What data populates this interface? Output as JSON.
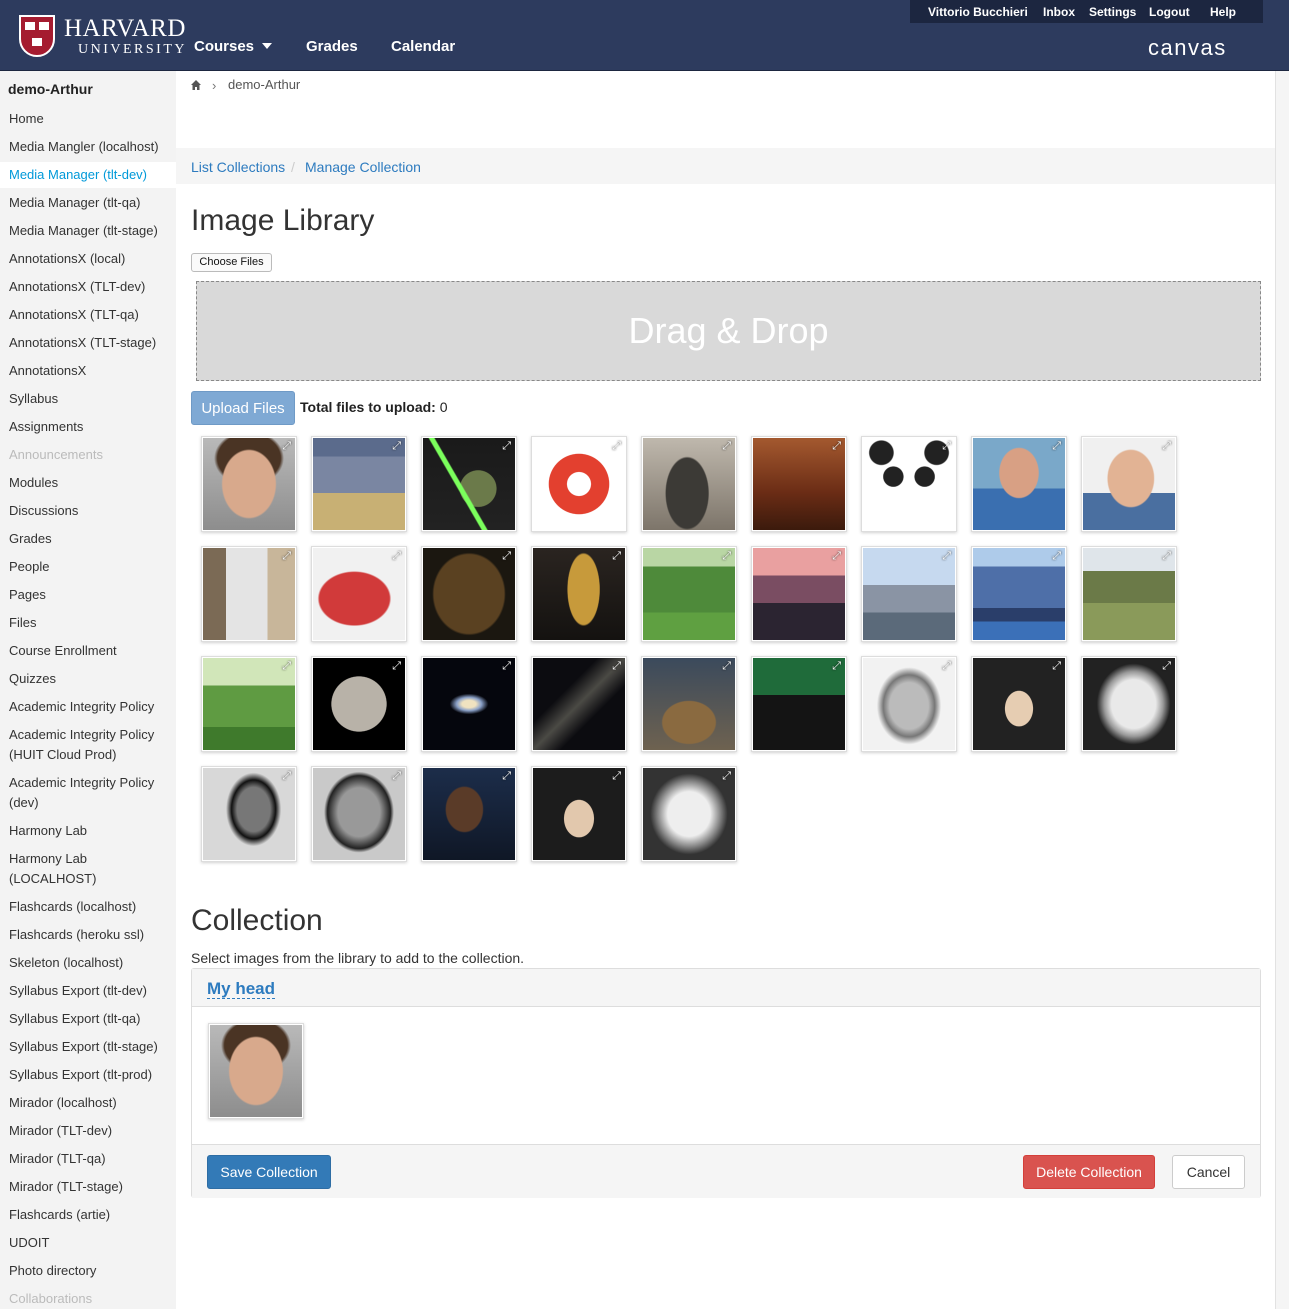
{
  "header": {
    "university_line1": "HARVARD",
    "university_line2": "UNIVERSITY",
    "main_nav": [
      {
        "label": "Courses",
        "dropdown": true
      },
      {
        "label": "Grades"
      },
      {
        "label": "Calendar"
      }
    ],
    "user_nav": [
      "Vittorio Bucchieri",
      "Inbox",
      "Settings",
      "Logout",
      "Help"
    ],
    "product": "canvas",
    "colors": {
      "bar": "#2d3b5e",
      "shield": "#a51c30"
    }
  },
  "sidebar": {
    "course": "demo-Arthur",
    "items": [
      {
        "label": "Home"
      },
      {
        "label": "Media Mangler (localhost)"
      },
      {
        "label": "Media Manager (tlt-dev)",
        "active": true
      },
      {
        "label": "Media Manager (tlt-qa)"
      },
      {
        "label": "Media Manager (tlt-stage)"
      },
      {
        "label": "AnnotationsX (local)"
      },
      {
        "label": "AnnotationsX (TLT-dev)"
      },
      {
        "label": "AnnotationsX (TLT-qa)"
      },
      {
        "label": "AnnotationsX (TLT-stage)"
      },
      {
        "label": "AnnotationsX"
      },
      {
        "label": "Syllabus"
      },
      {
        "label": "Assignments"
      },
      {
        "label": "Announcements",
        "disabled": true
      },
      {
        "label": "Modules"
      },
      {
        "label": "Discussions"
      },
      {
        "label": "Grades"
      },
      {
        "label": "People"
      },
      {
        "label": "Pages"
      },
      {
        "label": "Files"
      },
      {
        "label": "Course Enrollment"
      },
      {
        "label": "Quizzes"
      },
      {
        "label": "Academic Integrity Policy"
      },
      {
        "label": "Academic Integrity Policy",
        "line2": "(HUIT Cloud Prod)"
      },
      {
        "label": "Academic Integrity Policy",
        "line2": "(dev)"
      },
      {
        "label": "Harmony Lab"
      },
      {
        "label": "Harmony Lab",
        "line2": "(LOCALHOST)"
      },
      {
        "label": "Flashcards (localhost)"
      },
      {
        "label": "Flashcards (heroku ssl)"
      },
      {
        "label": "Skeleton (localhost)"
      },
      {
        "label": "Syllabus Export (tlt-dev)"
      },
      {
        "label": "Syllabus Export (tlt-qa)"
      },
      {
        "label": "Syllabus Export (tlt-stage)"
      },
      {
        "label": "Syllabus Export (tlt-prod)"
      },
      {
        "label": "Mirador (localhost)"
      },
      {
        "label": "Mirador (TLT-dev)"
      },
      {
        "label": "Mirador (TLT-qa)"
      },
      {
        "label": "Mirador (TLT-stage)"
      },
      {
        "label": "Flashcards (artie)"
      },
      {
        "label": "UDOIT"
      },
      {
        "label": "Photo directory"
      },
      {
        "label": "Collaborations",
        "disabled": true
      }
    ],
    "active_color": "#0099d9"
  },
  "breadcrumb": {
    "course": "demo-Arthur"
  },
  "subnav": {
    "list_collections": "List Collections",
    "separator": "/",
    "manage_collection": "Manage Collection"
  },
  "library": {
    "title": "Image Library",
    "choose_files": "Choose Files",
    "dropzone_text": "Drag & Drop",
    "upload_button": "Upload Files",
    "total_label": "Total files to upload:",
    "total_value": "0",
    "expand_glyph": "⤢",
    "images": [
      "portrait-man",
      "standard-comma-poster",
      "yoda-lightsaber",
      "canvas-logo",
      "harvard-statue",
      "library-hall",
      "crying-panda",
      "man-on-phone-1",
      "man-on-phone-2",
      "man-in-office",
      "red-fish-mascot",
      "chewbacca",
      "c3po-r2d2",
      "harvard-yard-trees",
      "city-sunset-street",
      "harbor-skyline",
      "boston-skyline",
      "machu-picchu",
      "harvard-yard-spring",
      "ceres-planet",
      "spiral-galaxy",
      "milky-way",
      "man-with-groundhog",
      "groundhog-day-crowd",
      "portrait-engraving-man",
      "george-washington-flag",
      "martin-van-buren",
      "abraham-lincoln",
      "theodore-roosevelt",
      "barack-obama",
      "washington-flag-2",
      "van-buren-2"
    ]
  },
  "collection": {
    "title": "Collection",
    "help": "Select images from the library to add to the collection.",
    "name": "My head",
    "items": [
      "portrait-man"
    ],
    "save": "Save Collection",
    "delete": "Delete Collection",
    "cancel": "Cancel",
    "colors": {
      "primary": "#337ab7",
      "danger": "#d9534f",
      "link": "#2d7bbf"
    }
  }
}
